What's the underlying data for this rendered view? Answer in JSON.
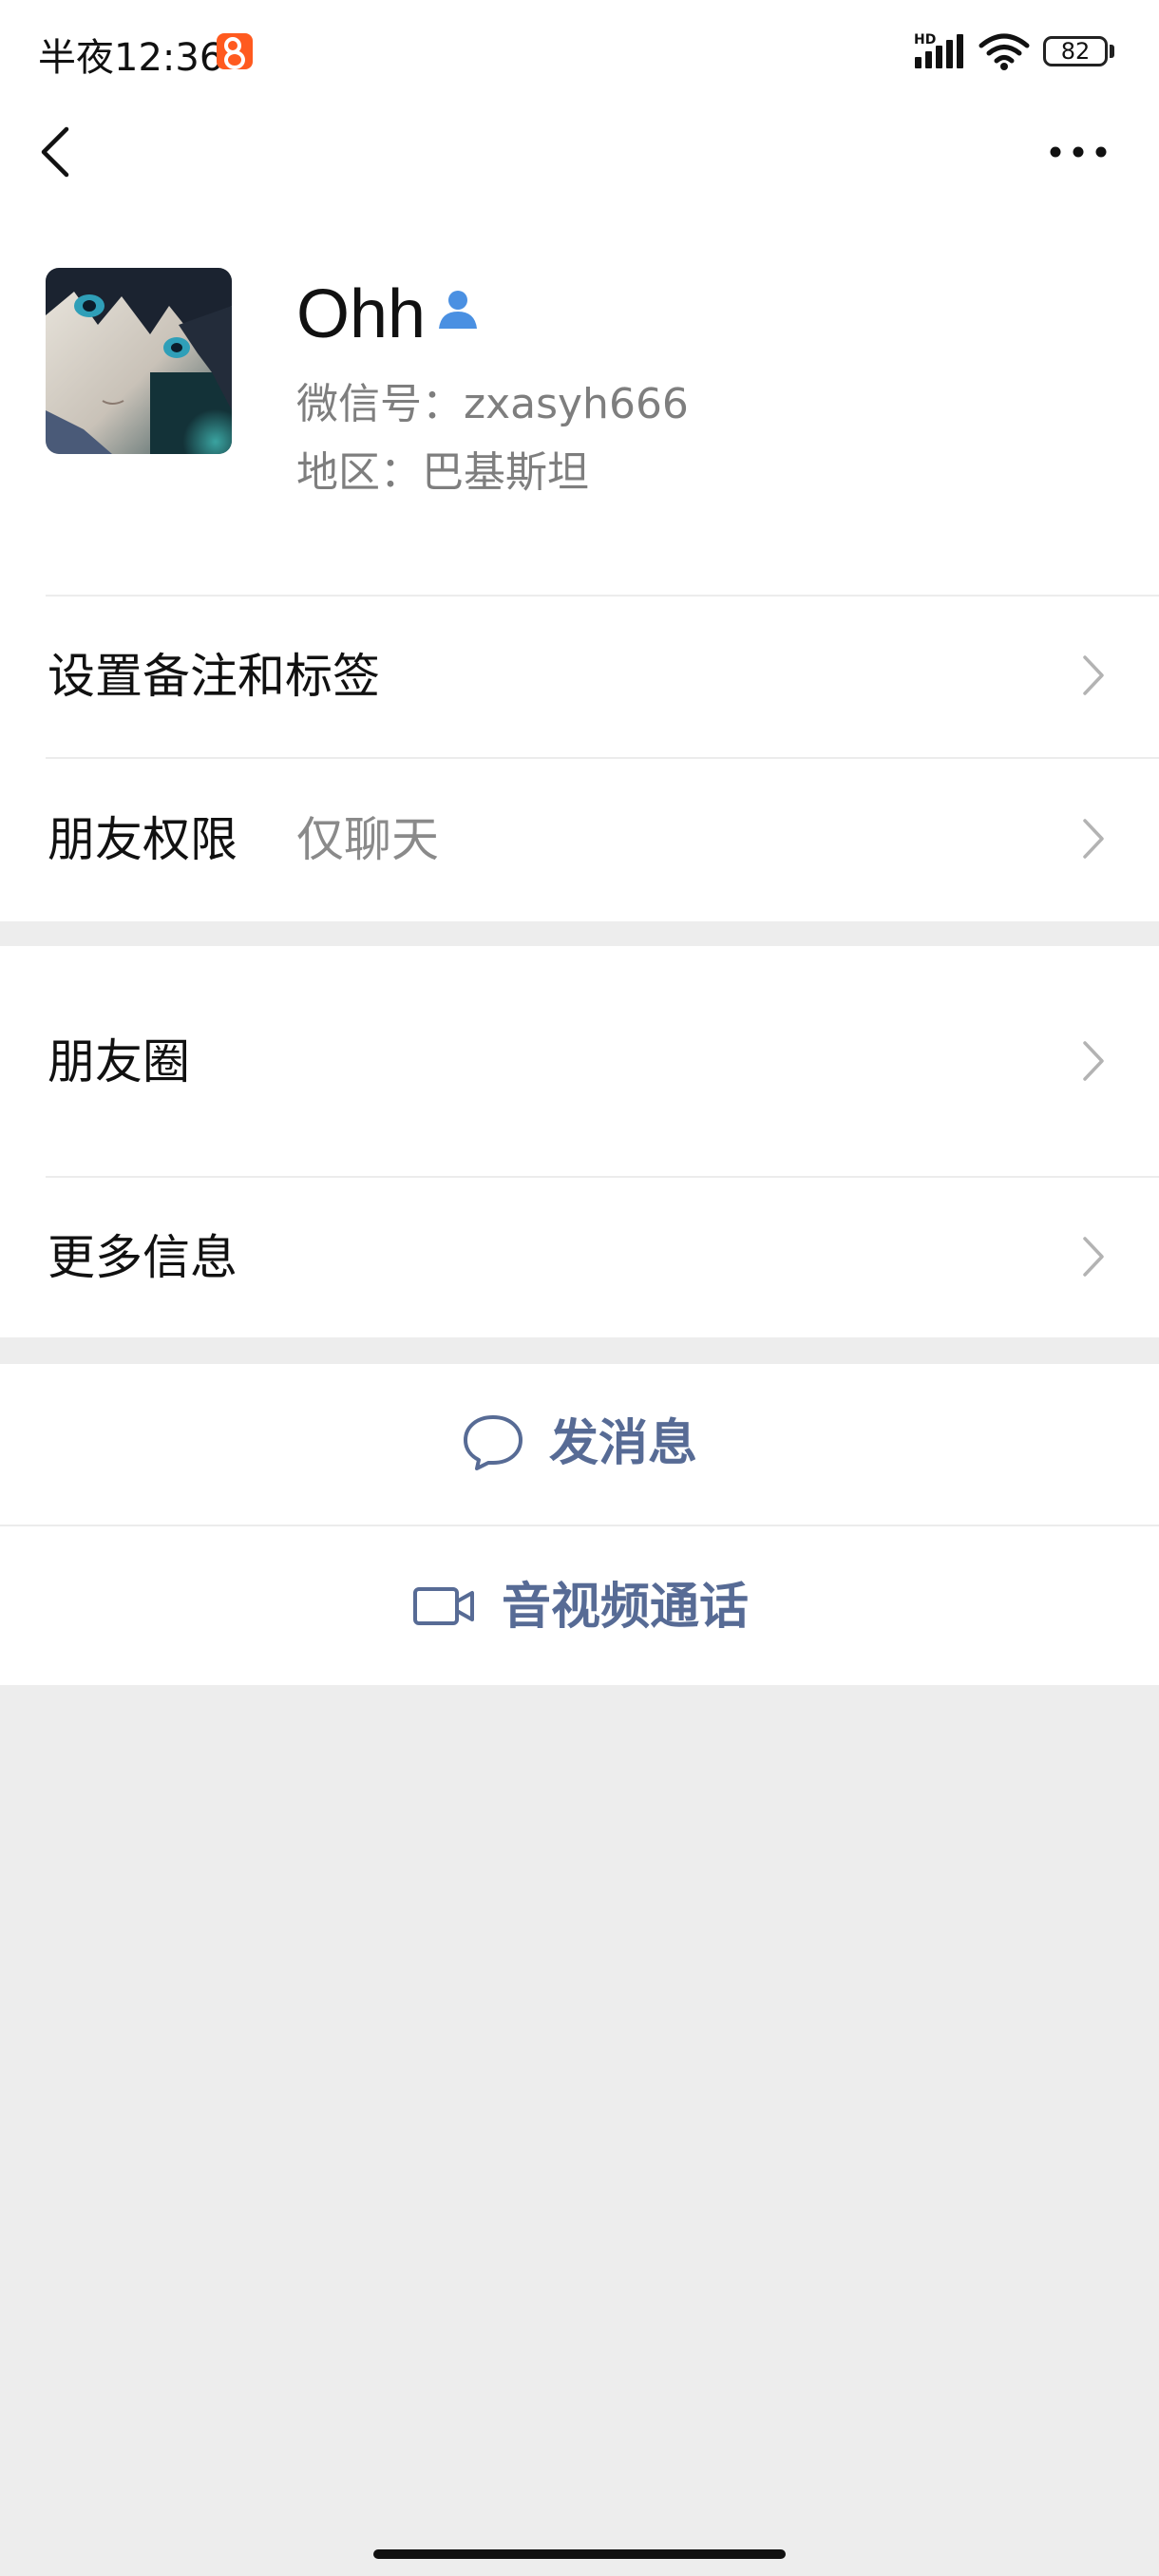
{
  "status_bar": {
    "time": "半夜12:36",
    "hd": "HD",
    "battery": "82"
  },
  "profile": {
    "name": "Ohh",
    "wechat_id": "微信号：zxasyh666",
    "region": "地区：巴基斯坦"
  },
  "rows": {
    "remark_label": "设置备注和标签",
    "permission_label": "朋友权限",
    "permission_value": "仅聊天",
    "moments_label": "朋友圈",
    "more_info_label": "更多信息"
  },
  "actions": {
    "message_label": "发消息",
    "call_label": "音视频通话"
  },
  "colors": {
    "accent": "#576b95",
    "contact_icon": "#4a90e2",
    "background": "#ededed"
  }
}
